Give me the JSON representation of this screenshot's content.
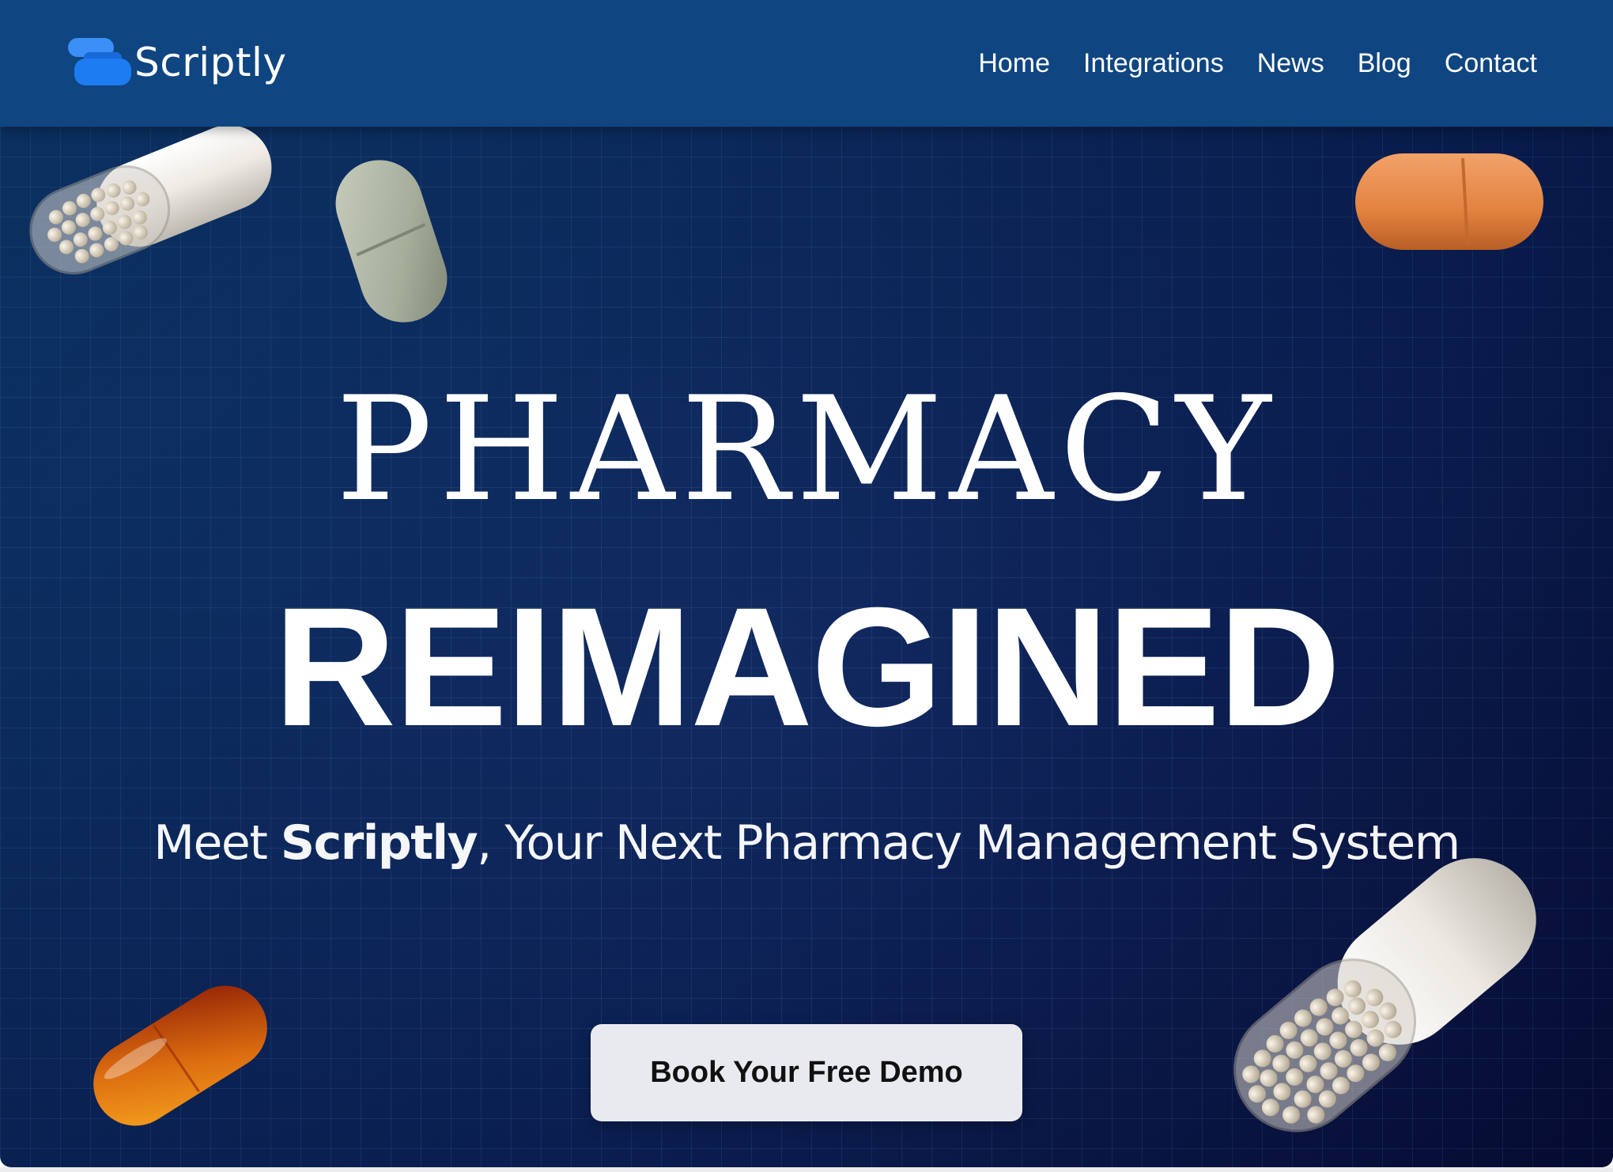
{
  "brand": {
    "name": "Scriptly",
    "accent": "#1e7cf2"
  },
  "nav": {
    "items": [
      {
        "label": "Home"
      },
      {
        "label": "Integrations"
      },
      {
        "label": "News"
      },
      {
        "label": "Blog"
      },
      {
        "label": "Contact"
      }
    ]
  },
  "hero": {
    "headline_top": "PHARMACY",
    "headline_bottom": "REIMAGINED",
    "subline_prefix": "Meet ",
    "subline_brand": "Scriptly",
    "subline_suffix": ", Your Next Pharmacy Management System",
    "cta_label": "Book Your Free Demo"
  },
  "colors": {
    "navbar_bg": "#0f4580",
    "hero_bg_start": "#0c3d78",
    "hero_bg_end": "#050c3a",
    "cta_bg": "#e9eaf0",
    "pill_orange": "#e88a45",
    "pill_sage": "#a6ad9a",
    "pill_amber": "#c8460d"
  },
  "decorations": {
    "pill_icons": [
      "capsule-beads-icon",
      "sage-tablet-icon",
      "orange-tablet-icon",
      "amber-softgel-icon",
      "large-capsule-beads-icon"
    ]
  }
}
